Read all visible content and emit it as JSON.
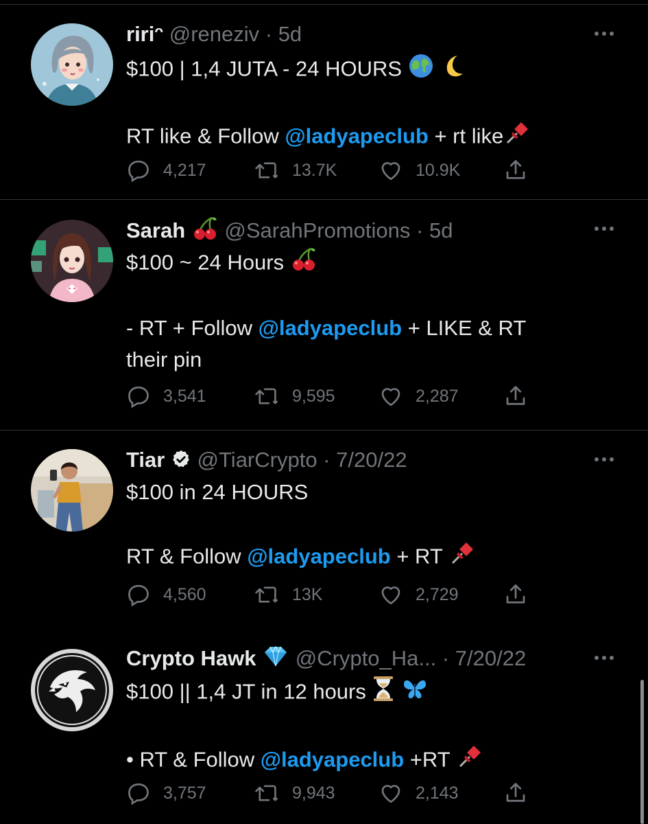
{
  "tweets": [
    {
      "name": "ririᵔ",
      "handle": "@reneziv",
      "dot": " · ",
      "date": "5d",
      "line1_text": "$100 | 1,4 JUTA - 24 HOURS ",
      "line2_before": "RT like & Follow ",
      "mention": "@ladyapeclub",
      "line2_after": " + rt like",
      "replies": "4,217",
      "retweets": "13.7K",
      "likes": "10.9K"
    },
    {
      "name": "Sarah ",
      "handle": "@SarahPromotions",
      "dot": " · ",
      "date": "5d",
      "line1_text": "$100 ~ 24 Hours ",
      "line2_before": "- RT + Follow ",
      "mention": "@ladyapeclub",
      "line2_after": " + LIKE & RT",
      "line3": "their pin",
      "replies": "3,541",
      "retweets": "9,595",
      "likes": "2,287"
    },
    {
      "name": "Tiar",
      "handle": "@TiarCrypto",
      "dot": " · ",
      "date": "7/20/22",
      "line1_text": "$100 in 24 HOURS",
      "line2_before": "RT & Follow ",
      "mention": "@ladyapeclub",
      "line2_after": " + RT ",
      "replies": "4,560",
      "retweets": "13K",
      "likes": "2,729"
    },
    {
      "name": "Crypto Hawk ",
      "handle": "@Crypto_Ha...",
      "dot": " · ",
      "date": "7/20/22",
      "line1_text": "$100 || 1,4 JT  in 12 hours ",
      "line2_before": "• RT & Follow ",
      "mention": "@ladyapeclub",
      "line2_after": " +RT ",
      "replies": "3,757",
      "retweets": "9,943",
      "likes": "2,143"
    }
  ],
  "icons": {
    "reply": "reply-icon",
    "retweet": "retweet-icon",
    "like": "heart-icon",
    "share": "share-icon",
    "more": "more-icon"
  },
  "colors": {
    "background": "#000000",
    "text": "#e7e9ea",
    "muted": "#71767b",
    "mention": "#1d9bf0",
    "separator": "#2f3336"
  }
}
